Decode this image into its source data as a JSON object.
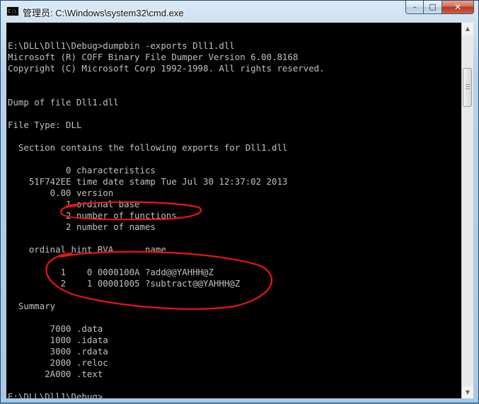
{
  "window": {
    "icon_text": "C:\\",
    "title": "管理员: C:\\Windows\\system32\\cmd.exe",
    "buttons": {
      "minimize": "–",
      "maximize": "□",
      "close": "✕"
    }
  },
  "console": {
    "lines": [
      "",
      "E:\\DLL\\Dll1\\Debug>dumpbin -exports Dll1.dll",
      "Microsoft (R) COFF Binary File Dumper Version 6.00.8168",
      "Copyright (C) Microsoft Corp 1992-1998. All rights reserved.",
      "",
      "",
      "Dump of file Dll1.dll",
      "",
      "File Type: DLL",
      "",
      "  Section contains the following exports for Dll1.dll",
      "",
      "           0 characteristics",
      "    51F742EE time date stamp Tue Jul 30 12:37:02 2013",
      "        0.00 version",
      "           1 ordinal base",
      "           2 number of functions",
      "           2 number of names",
      "",
      "    ordinal hint RVA      name",
      "",
      "          1    0 0000100A ?add@@YAHHH@Z",
      "          2    1 00001005 ?subtract@@YAHHH@Z",
      "",
      "  Summary",
      "",
      "        7000 .data",
      "        1000 .idata",
      "        3000 .rdata",
      "        2000 .reloc",
      "       2A000 .text",
      "",
      "E:\\DLL\\Dll1\\Debug>"
    ]
  },
  "scrollbar": {
    "up_arrow": "▲",
    "down_arrow": "▼"
  },
  "annotation_color": "#e8141b"
}
